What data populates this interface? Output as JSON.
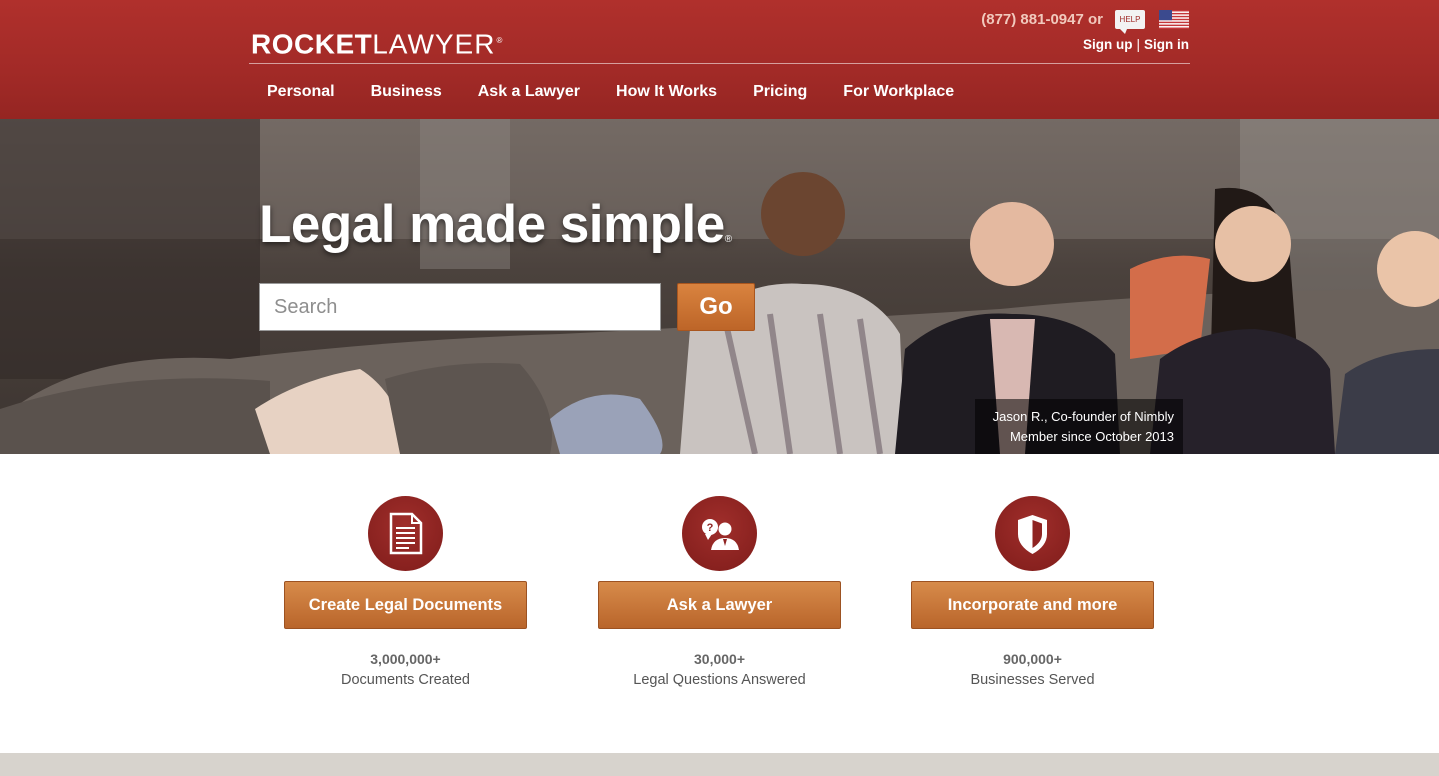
{
  "header": {
    "logo_bold": "ROCKET",
    "logo_light": "LAWYER",
    "logo_mark": "®",
    "phone": "(877) 881-0947 or",
    "help_label": "HELP",
    "flag_icon": "us-flag-icon",
    "sign_up": "Sign up",
    "separator": "|",
    "sign_in": "Sign in",
    "bg_color": "#a62b28"
  },
  "nav": {
    "items": [
      {
        "label": "Personal"
      },
      {
        "label": "Business"
      },
      {
        "label": "Ask a Lawyer"
      },
      {
        "label": "How It Works"
      },
      {
        "label": "Pricing"
      },
      {
        "label": "For Workplace"
      }
    ]
  },
  "hero": {
    "title": "Legal made simple",
    "title_mark": "®",
    "search_placeholder": "Search",
    "go_label": "Go",
    "caption_line1": "Jason R., Co-founder of Nimbly",
    "caption_line2": "Member since October 2013"
  },
  "features": [
    {
      "icon": "document-icon",
      "button": "Create Legal Documents",
      "stat": "3,000,000+",
      "desc": "Documents Created"
    },
    {
      "icon": "ask-lawyer-icon",
      "button": "Ask a Lawyer",
      "stat": "30,000+",
      "desc": "Legal Questions Answered"
    },
    {
      "icon": "shield-icon",
      "button": "Incorporate and more",
      "stat": "900,000+",
      "desc": "Businesses Served"
    }
  ],
  "colors": {
    "accent_orange": "#c8702f",
    "icon_red": "#8f2422"
  }
}
